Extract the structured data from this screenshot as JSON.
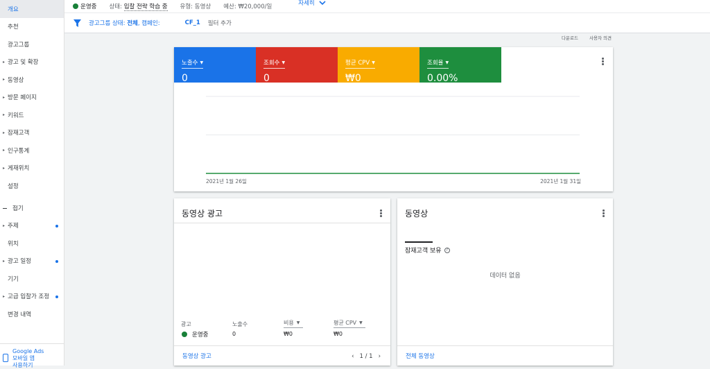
{
  "sidebar": {
    "items": [
      {
        "label": "개요",
        "active": true,
        "arrow": false,
        "dot": false
      },
      {
        "label": "추천",
        "active": false,
        "arrow": false,
        "dot": false
      },
      {
        "label": "광고그룹",
        "active": false,
        "arrow": false,
        "dot": false
      },
      {
        "label": "광고 및 확장",
        "active": false,
        "arrow": true,
        "dot": false
      },
      {
        "label": "동영상",
        "active": false,
        "arrow": true,
        "dot": false
      },
      {
        "label": "방문 페이지",
        "active": false,
        "arrow": true,
        "dot": false
      },
      {
        "label": "키워드",
        "active": false,
        "arrow": true,
        "dot": false
      },
      {
        "label": "잠재고객",
        "active": false,
        "arrow": true,
        "dot": false
      },
      {
        "label": "인구통계",
        "active": false,
        "arrow": true,
        "dot": false
      },
      {
        "label": "게재위치",
        "active": false,
        "arrow": true,
        "dot": false
      },
      {
        "label": "설정",
        "active": false,
        "arrow": false,
        "dot": false
      }
    ],
    "fold_label": "접기",
    "extra_items": [
      {
        "label": "주제",
        "arrow": true,
        "dot": true
      },
      {
        "label": "위치",
        "arrow": false,
        "dot": false
      },
      {
        "label": "광고 일정",
        "arrow": true,
        "dot": true
      },
      {
        "label": "기기",
        "arrow": false,
        "dot": false
      },
      {
        "label": "고급 입찰가 조정",
        "arrow": true,
        "dot": true
      },
      {
        "label": "변경 내역",
        "arrow": false,
        "dot": false
      }
    ],
    "mobile_app": {
      "line1": "Google Ads",
      "line2": "모바일 앱",
      "line3": "사용하기"
    }
  },
  "statusbar": {
    "status": "운영중",
    "state_label": "상태:",
    "state_value": "입찰 전략 학습 중",
    "type_label": "유형:",
    "type_value": "동영상",
    "budget_label": "예산:",
    "budget_value": "₩20,000/일",
    "detail": "자세히"
  },
  "filterbar": {
    "crumb_prefix": "광고그룹 상태:",
    "crumb_bold": "전체",
    "crumb_suffix": ", 캠페인:",
    "chip": "CF_1",
    "add_filter": "필터 추가"
  },
  "toplinks": {
    "download": "다운로드",
    "custom": "사용자 의견"
  },
  "metrics": [
    {
      "label": "노출수",
      "value": "0",
      "color": "#1a73e8"
    },
    {
      "label": "조회수",
      "value": "0",
      "color": "#d93025"
    },
    {
      "label": "평균 CPV",
      "value": "₩0",
      "color": "#f9ab00"
    },
    {
      "label": "조회율",
      "value": "0.00%",
      "color": "#1e8e3e"
    }
  ],
  "chart": {
    "x_start_label": "2021년 1월 26일",
    "x_end_label": "2021년 1월 31일"
  },
  "chart_data": {
    "type": "line",
    "x": [
      "2021년 1월 26일",
      "2021년 1월 31일"
    ],
    "series": [
      {
        "values": [
          0,
          0
        ],
        "color": "#1e8e3e"
      }
    ]
  },
  "video_ads_card": {
    "title": "동영상 광고",
    "columns": [
      "광고",
      "노출수",
      "비용",
      "평균 CPV"
    ],
    "row": {
      "status": "운영중",
      "impressions": "0",
      "cost": "₩0",
      "cpv": "₩0"
    },
    "footer_link": "동영상 광고",
    "pager": "1 / 1"
  },
  "video_card": {
    "title": "동영상",
    "subtitle": "잠재고객 보유",
    "empty": "데이터 없음",
    "footer_link": "전체 동영상"
  }
}
